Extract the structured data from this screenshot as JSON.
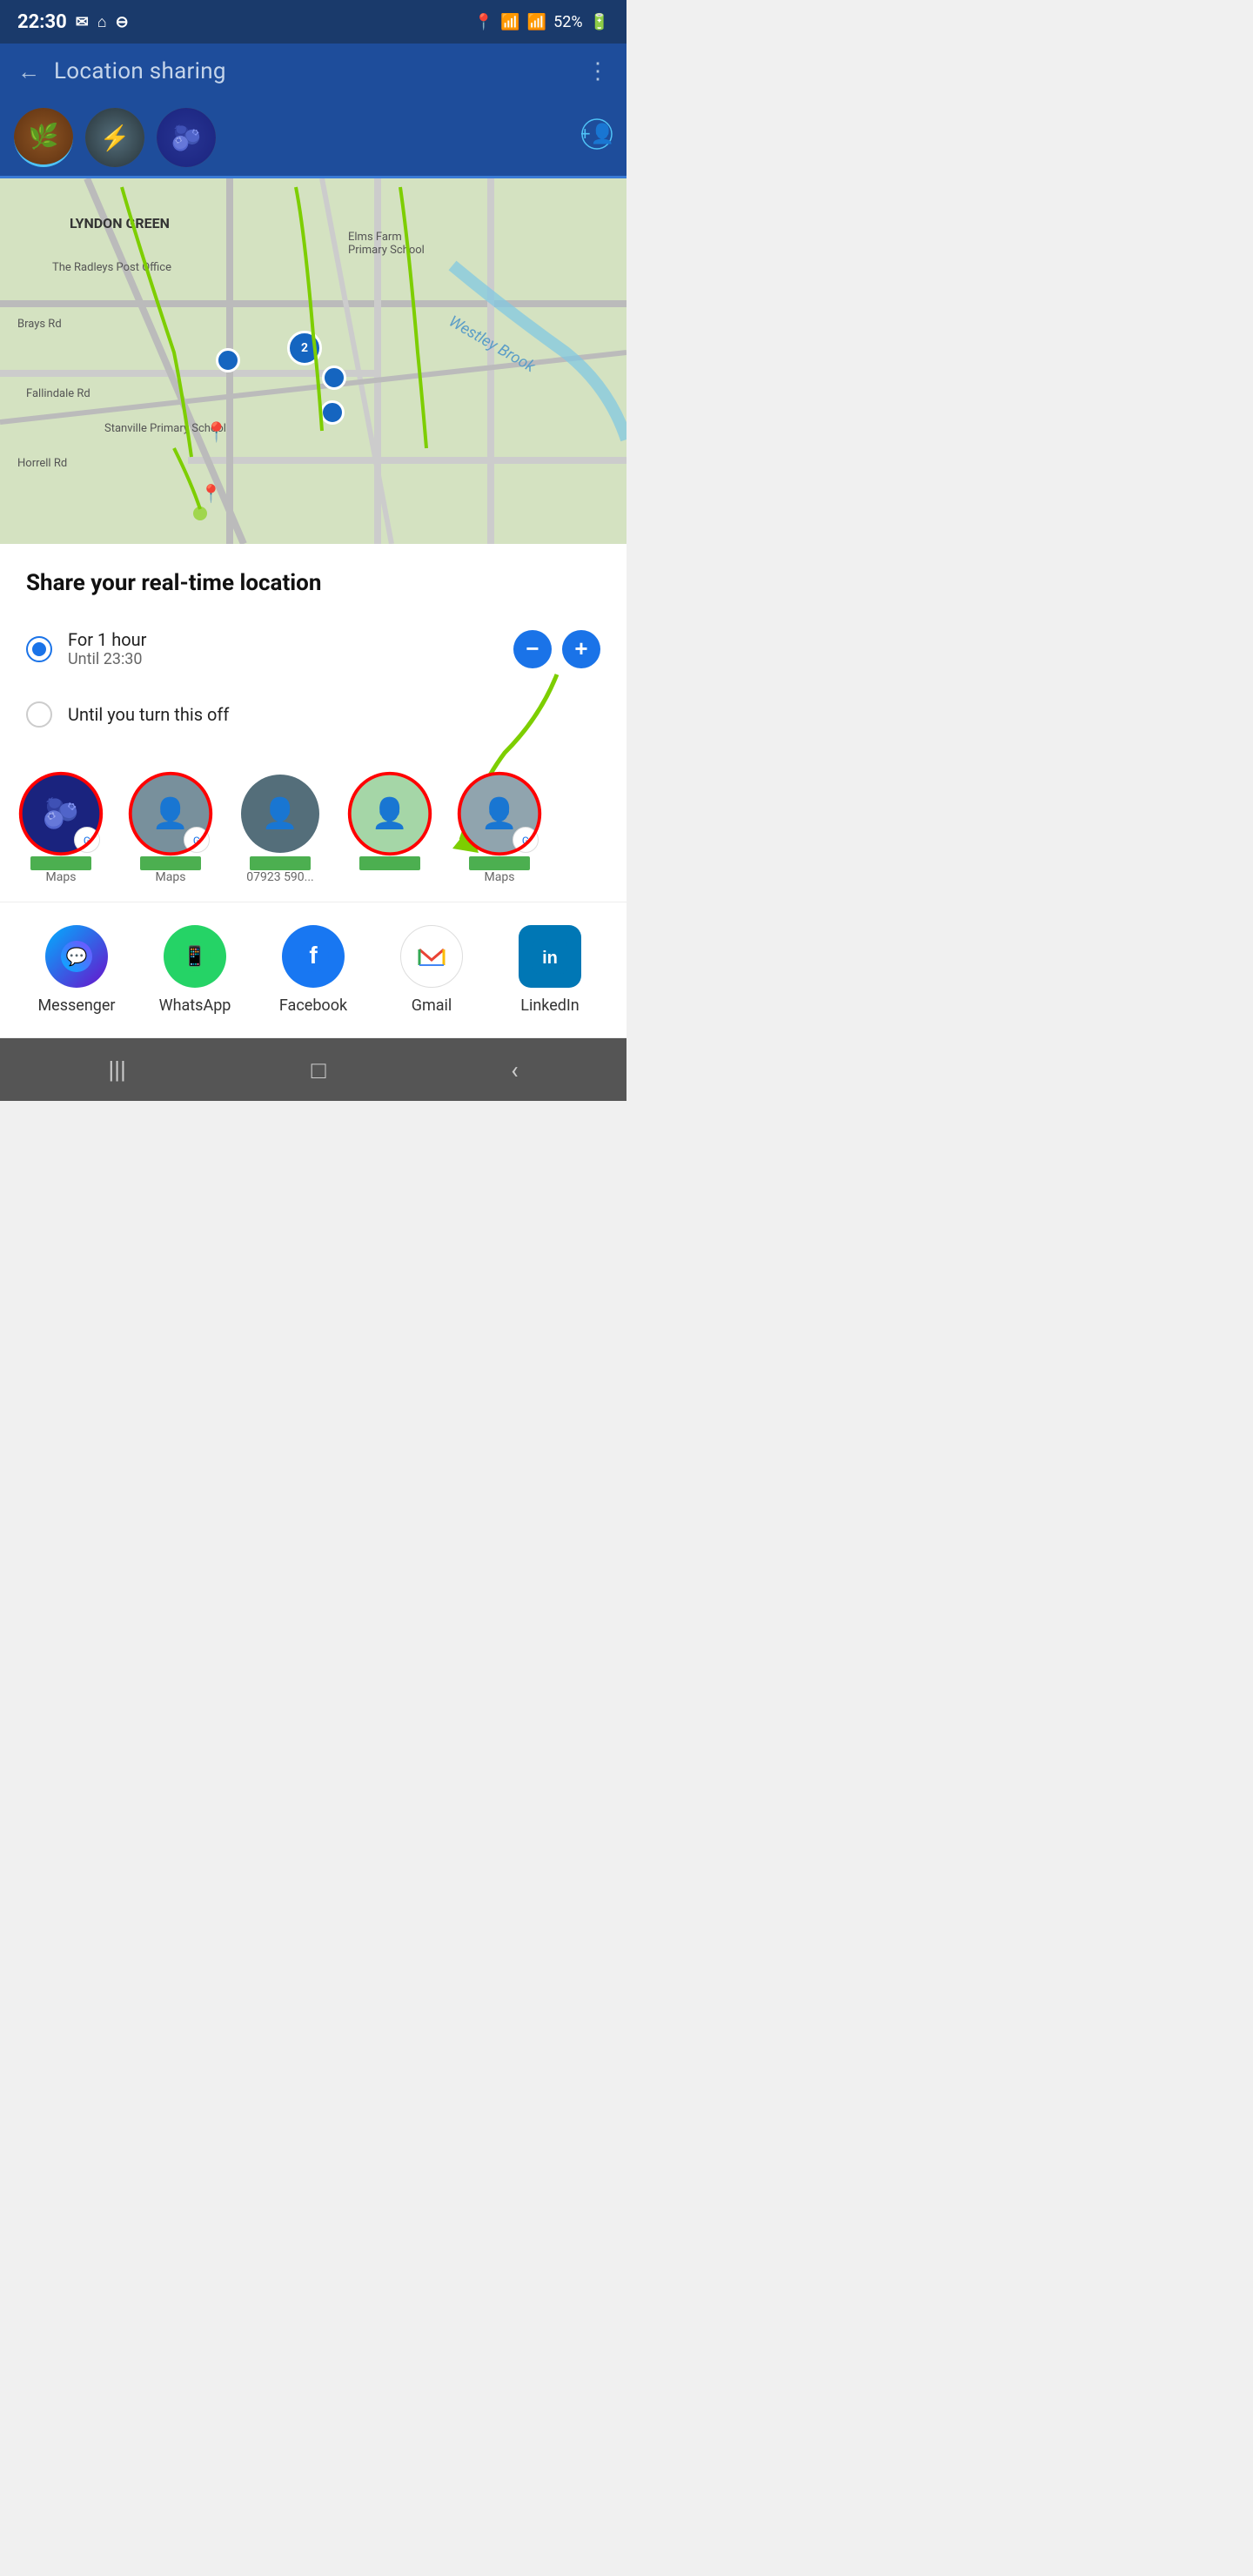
{
  "status_bar": {
    "time": "22:30",
    "battery": "52%",
    "icons": [
      "email",
      "home",
      "minus",
      "location",
      "wifi",
      "signal"
    ]
  },
  "top_bar": {
    "back_label": "←",
    "title": "Location sharing",
    "more_label": "⋮"
  },
  "contacts": [
    {
      "id": "c1",
      "avatar_class": "av-brown",
      "active": true
    },
    {
      "id": "c2",
      "avatar_class": "av-darkgray",
      "active": false
    },
    {
      "id": "c3",
      "avatar_class": "av-blueberry",
      "active": false
    }
  ],
  "add_person_label": "➕",
  "map": {
    "area_label": "LYNDON GREEN",
    "places": [
      "The Radleys Post Office",
      "Elms Farm Primary School",
      "Stanville Primary School",
      "Westley Brook"
    ]
  },
  "share": {
    "title": "Share your real-time location",
    "option1_main": "For 1 hour",
    "option1_sub": "Until 23:30",
    "option2_main": "Until you turn this off",
    "minus_label": "−",
    "plus_label": "+"
  },
  "contact_shares": [
    {
      "name_label": "Maps",
      "has_maps": true,
      "redacted": true
    },
    {
      "name_label": "Maps",
      "has_maps": true,
      "redacted": true
    },
    {
      "name_label": "07923 590...",
      "has_maps": false,
      "redacted": true
    },
    {
      "name_label": "",
      "has_maps": false,
      "redacted": true
    },
    {
      "name_label": "Maps",
      "has_maps": true,
      "redacted": true
    }
  ],
  "apps": [
    {
      "id": "messenger",
      "label": "Messenger",
      "icon_char": "💬",
      "icon_class": "messenger"
    },
    {
      "id": "whatsapp",
      "label": "WhatsApp",
      "icon_char": "📱",
      "icon_class": "whatsapp"
    },
    {
      "id": "facebook",
      "label": "Facebook",
      "icon_char": "f",
      "icon_class": "facebook"
    },
    {
      "id": "gmail",
      "label": "Gmail",
      "icon_char": "M",
      "icon_class": "gmail"
    },
    {
      "id": "linkedin",
      "label": "LinkedIn",
      "icon_char": "in",
      "icon_class": "linkedin"
    }
  ],
  "nav": {
    "menu_icon": "|||",
    "home_icon": "□",
    "back_icon": "‹"
  }
}
